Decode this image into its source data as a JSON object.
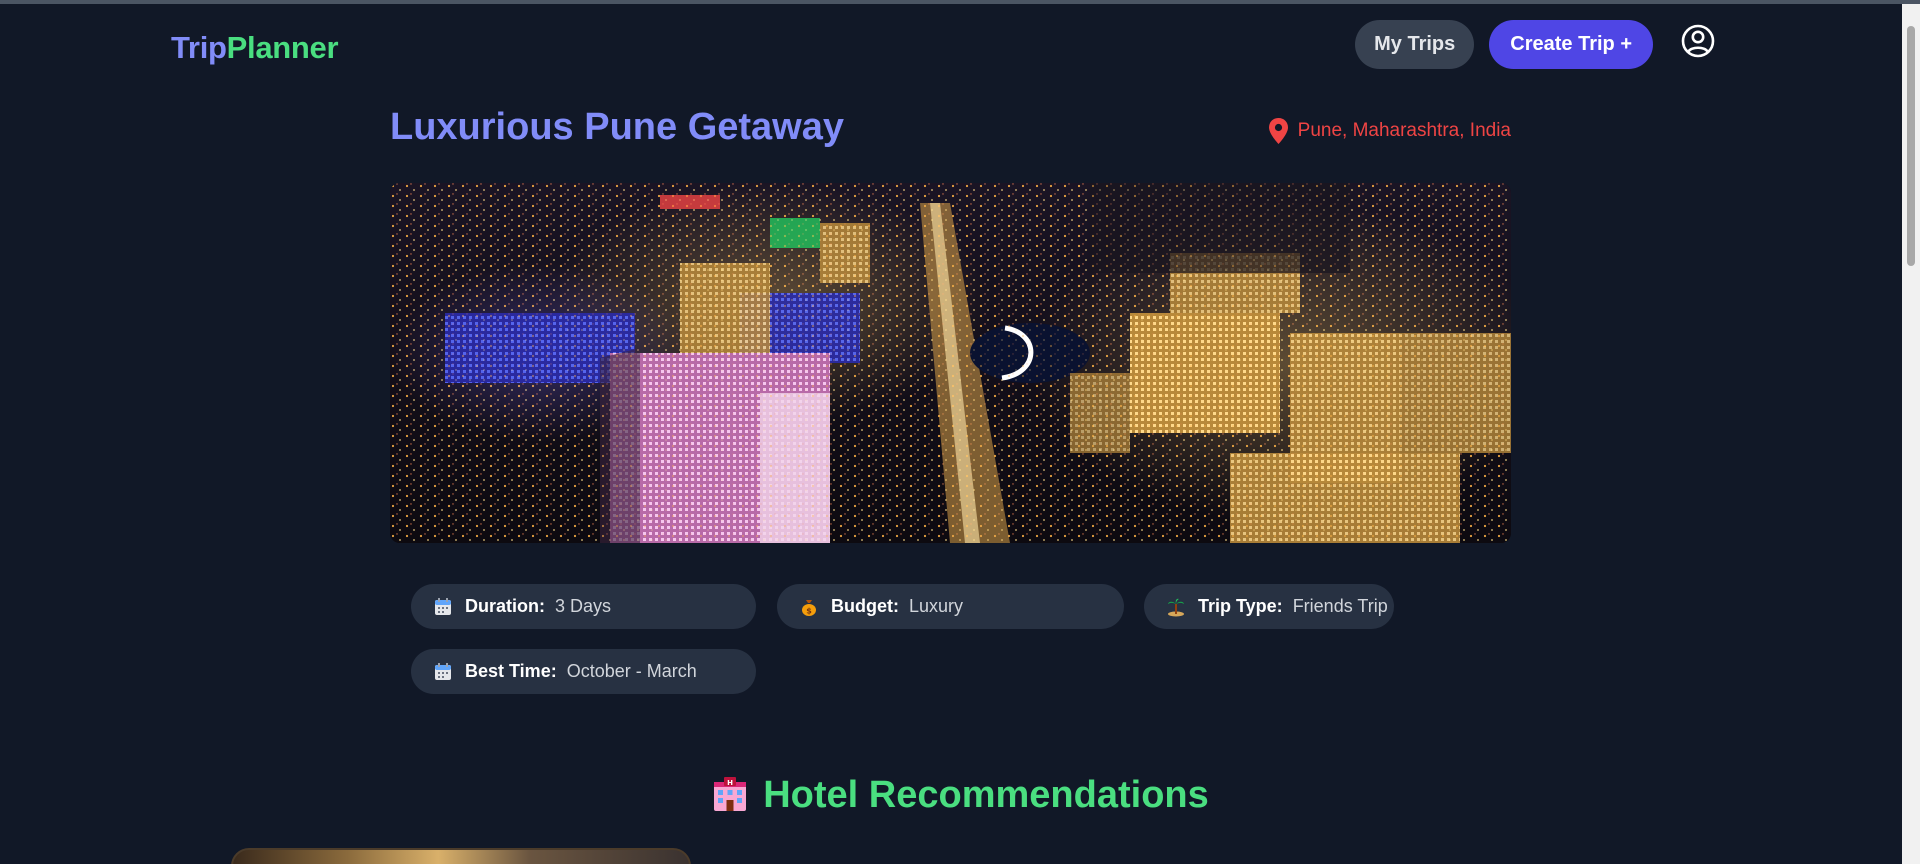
{
  "header": {
    "logo_part1": "Trip",
    "logo_part2": "Planner",
    "my_trips_label": "My Trips",
    "create_trip_label": "Create Trip +",
    "profile_icon": "user-circle-icon"
  },
  "trip": {
    "title": "Luxurious Pune Getaway",
    "location": "Pune, Maharashtra, India",
    "location_icon": "map-pin-icon",
    "hero_image": "city-night-aerial"
  },
  "info": [
    {
      "icon": "calendar-icon",
      "label": "Duration:",
      "value": "3 Days"
    },
    {
      "icon": "money-bag-icon",
      "label": "Budget:",
      "value": "Luxury"
    },
    {
      "icon": "palm-island-icon",
      "label": "Trip Type:",
      "value": "Friends Trip"
    },
    {
      "icon": "calendar-icon",
      "label": "Best Time:",
      "value": "October - March"
    }
  ],
  "hotels": {
    "icon": "hotel-icon",
    "heading": "Hotel Recommendations"
  },
  "colors": {
    "background": "#111827",
    "accent_indigo": "#818cf8",
    "accent_green": "#4ade80",
    "primary_button": "#4f46e5",
    "location_red": "#ef4444",
    "pill_bg": "#273142"
  }
}
